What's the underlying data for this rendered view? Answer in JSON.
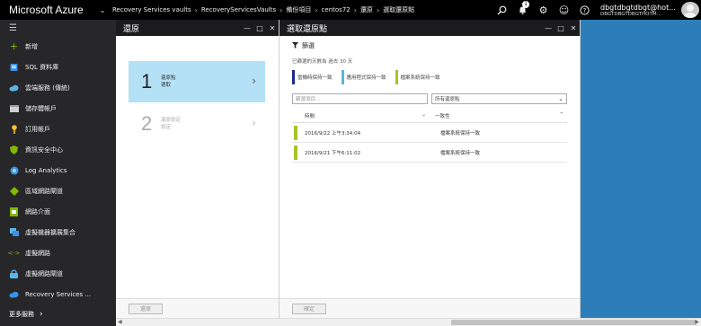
{
  "topbar": {
    "brand": "Microsoft Azure",
    "breadcrumbs": [
      "Recovery Services vaults",
      "RecoveryServicesVaults",
      "備份項目",
      "centos72",
      "還原",
      "選取還原點"
    ],
    "notification_count": "1",
    "user_name": "dbgtdbgtdbgt@hot...",
    "user_directory": "DBGTDBGTDBGTHOTM..."
  },
  "sidebar": {
    "new_label": "新增",
    "items": [
      {
        "label": "SQL 資料庫",
        "icon": "sql-database-icon"
      },
      {
        "label": "雲端服務 (傳統)",
        "icon": "cloud-service-icon"
      },
      {
        "label": "儲存體帳戶",
        "icon": "storage-account-icon"
      },
      {
        "label": "訂用帳戶",
        "icon": "subscription-key-icon"
      },
      {
        "label": "資訊安全中心",
        "icon": "security-center-icon"
      },
      {
        "label": "Log Analytics",
        "icon": "log-analytics-icon"
      },
      {
        "label": "區域網路閘道",
        "icon": "local-gateway-icon"
      },
      {
        "label": "網路介面",
        "icon": "network-interface-icon"
      },
      {
        "label": "虛擬機器擴展集合",
        "icon": "vm-scale-set-icon"
      },
      {
        "label": "虛擬網路",
        "icon": "virtual-network-icon"
      },
      {
        "label": "虛擬網路閘道",
        "icon": "vnet-gateway-icon"
      },
      {
        "label": "Recovery Services ...",
        "icon": "recovery-services-icon"
      }
    ],
    "more_label": "更多服務"
  },
  "restore_blade": {
    "title": "還原",
    "step1": {
      "number": "1",
      "line1": "還原點",
      "line2": "選取"
    },
    "step2": {
      "number": "2",
      "line1": "還原設定",
      "line2": "設定"
    },
    "footer_button": "還原"
  },
  "select_blade": {
    "title": "選取還原點",
    "filter_label": "篩選",
    "info_text": "已篩選的天數為 過去 30 天",
    "legend": [
      {
        "label": "當機時保持一致",
        "color": "#1f2b88"
      },
      {
        "label": "應用程式保持一致",
        "color": "#5fb3d9"
      },
      {
        "label": "檔案系統保持一致",
        "color": "#a4c52e"
      }
    ],
    "search_placeholder": "篩選項目...",
    "select_value": "所有還原點",
    "columns": {
      "time": "時間",
      "consistency": "一致性"
    },
    "rows": [
      {
        "time": "2016/9/22 上午3:34:04",
        "consistency": "檔案系統保持一致",
        "color": "#a4c52e"
      },
      {
        "time": "2016/9/21 下午6:11:02",
        "consistency": "檔案系統保持一致",
        "color": "#a4c52e"
      }
    ],
    "footer_button": "確定"
  }
}
